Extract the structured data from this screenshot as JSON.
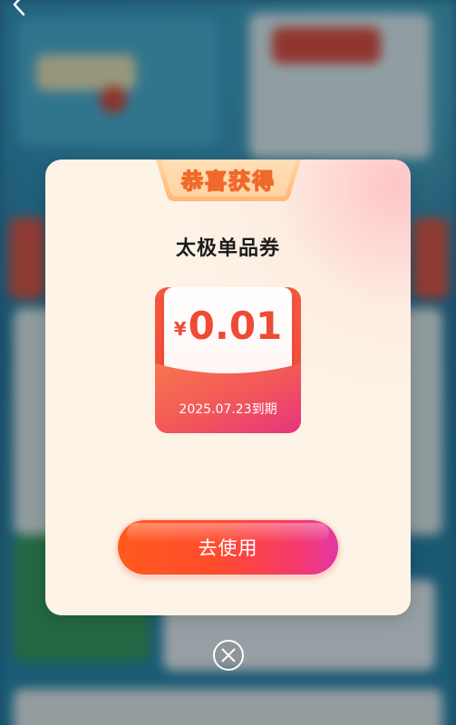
{
  "modal": {
    "ribbon_title": "恭喜获得",
    "coupon_name": "太极单品券",
    "coupon": {
      "currency": "¥",
      "amount": "0.01",
      "expiry": "2025.07.23到期"
    },
    "use_button_label": "去使用"
  },
  "icons": {
    "back": "back-arrow-icon",
    "close": "close-circle-icon"
  },
  "colors": {
    "modal_bg": "#fdf3e6",
    "ribbon_orange": "#f08a3a",
    "coupon_red": "#f04e3d",
    "coupon_pink": "#ea3963",
    "button_start": "#ff5a1e",
    "button_end": "#e436a3"
  }
}
